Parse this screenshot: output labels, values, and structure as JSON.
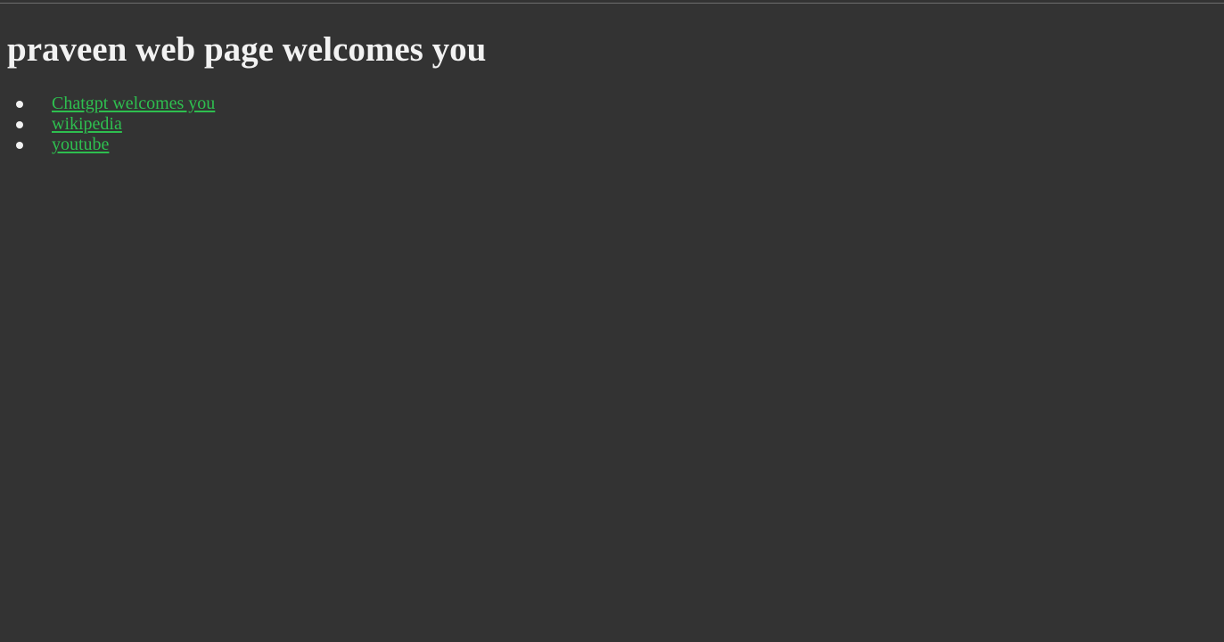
{
  "page": {
    "title": "praveen web page welcomes you",
    "colors": {
      "background": "#333333",
      "text": "#f2f2f2",
      "link": "#2ebf4f",
      "top_rule": "#6e6e6e"
    }
  },
  "links": [
    {
      "label": "Chatgpt welcomes you"
    },
    {
      "label": "wikipedia"
    },
    {
      "label": "youtube"
    }
  ]
}
